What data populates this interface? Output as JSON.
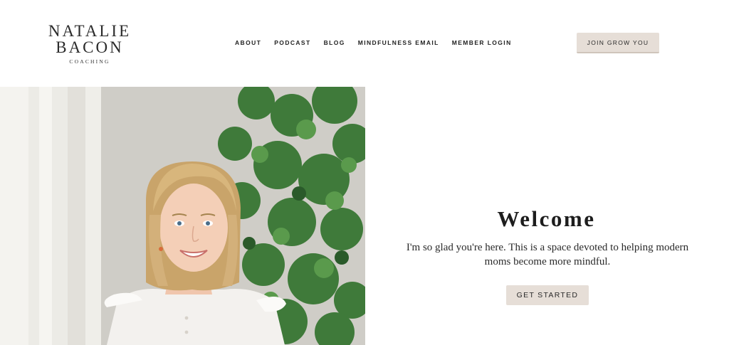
{
  "logo": {
    "line1": "NATALIE",
    "line2": "BACON",
    "sub": "COACHING"
  },
  "nav": {
    "items": [
      "ABOUT",
      "PODCAST",
      "BLOG",
      "MINDFULNESS EMAIL",
      "MEMBER LOGIN"
    ]
  },
  "header": {
    "join_label": "JOIN GROW YOU"
  },
  "hero": {
    "image": "portrait of smiling blonde woman beside a leafy plant and sheer curtain"
  },
  "welcome": {
    "title": "Welcome",
    "text": "I'm so glad you're here. This is a space devoted to helping modern moms become more mindful.",
    "cta_label": "GET STARTED"
  },
  "colors": {
    "button_bg": "#e6ded7",
    "text": "#222222"
  }
}
